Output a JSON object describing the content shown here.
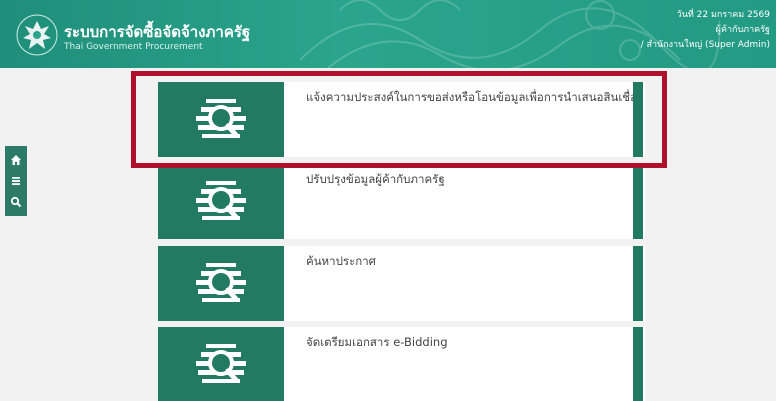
{
  "header": {
    "title": "ระบบการจัดซื้อจัดจ้างภาครัฐ",
    "subtitle": "Thai Government Procurement",
    "date": "วันที่ 22 มกราคม 2569",
    "role": "ผู้ค้ากับภาครัฐ",
    "office": "/ สำนักงานใหญ่ (Super Admin)"
  },
  "sidebar": {
    "items": [
      {
        "icon": "home-icon"
      },
      {
        "icon": "menu-icon"
      },
      {
        "icon": "search-icon"
      }
    ]
  },
  "menu": {
    "items": [
      {
        "label": "แจ้งความประสงค์ในการขอส่งหรือโอนข้อมูลเพื่อการนำเสนอสินเชื่อ",
        "selected": true
      },
      {
        "label": "ปรับปรุงข้อมูลผู้ค้ากับภาครัฐ"
      },
      {
        "label": "ค้นหาประกาศ"
      },
      {
        "label": "จัดเตรียมเอกสาร e-Bidding"
      }
    ]
  },
  "colors": {
    "header_bg": "#2aa58c",
    "card_accent": "#237a62",
    "highlight": "#b0122e"
  }
}
